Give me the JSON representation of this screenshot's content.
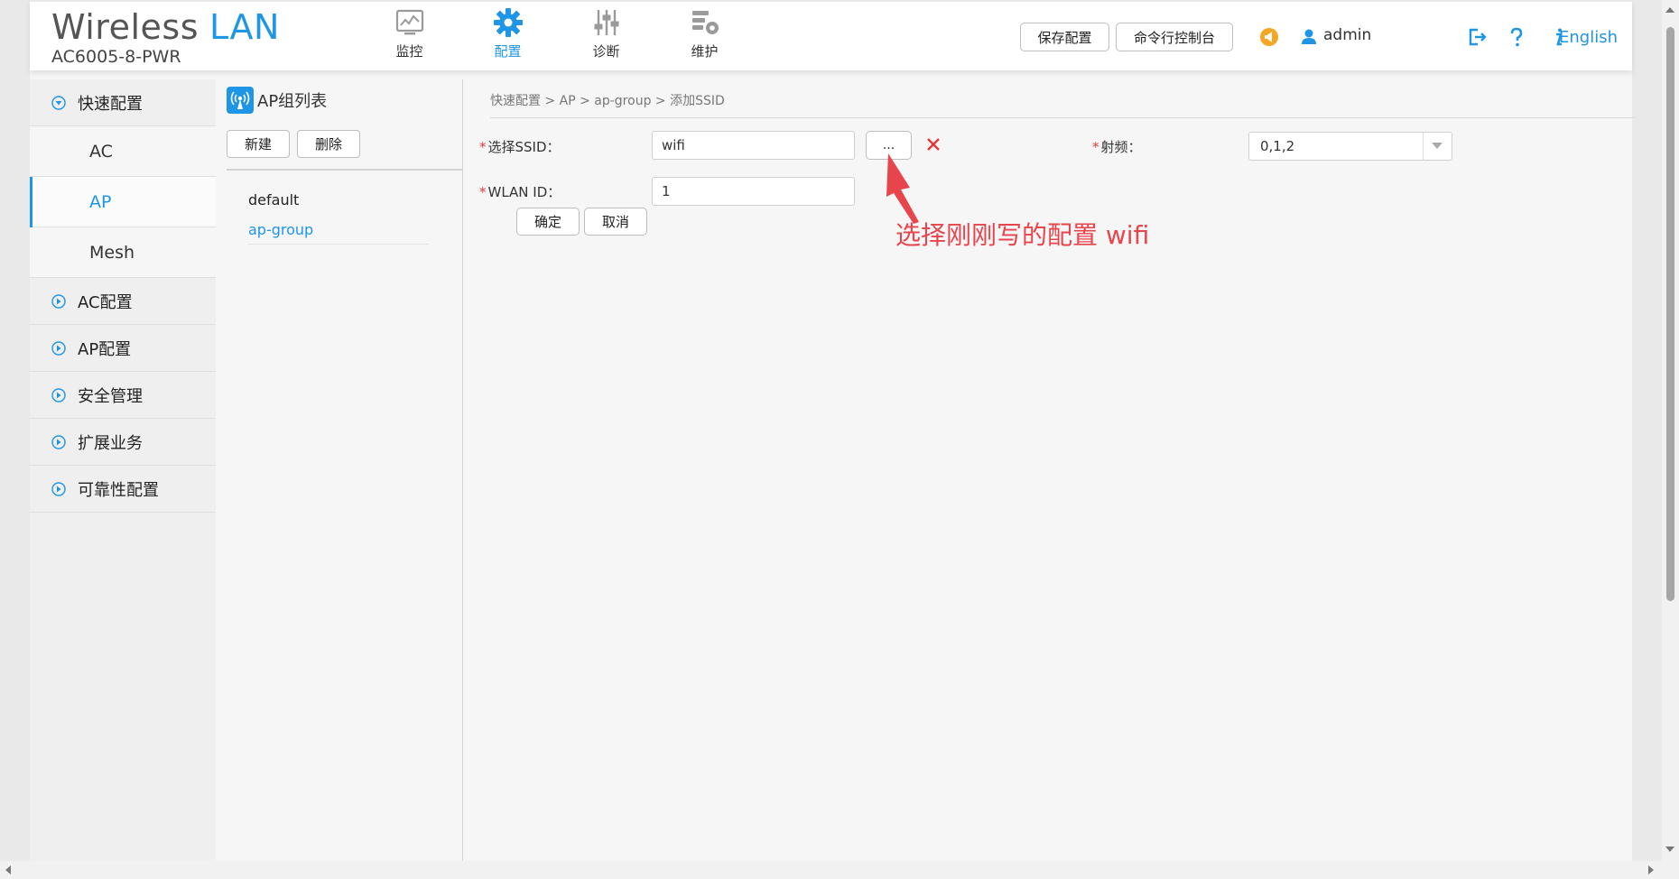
{
  "header": {
    "logo_word1": "Wireless",
    "logo_word2": "LAN",
    "model": "AC6005-8-PWR",
    "nav": [
      {
        "label": "监控",
        "icon": "monitor-icon"
      },
      {
        "label": "配置",
        "icon": "gear-icon",
        "active": true
      },
      {
        "label": "诊断",
        "icon": "sliders-icon"
      },
      {
        "label": "维护",
        "icon": "maintenance-icon"
      }
    ],
    "save_config_label": "保存配置",
    "cli_console_label": "命令行控制台",
    "user": "admin",
    "language": "English",
    "icons": [
      "alarm-icon",
      "user-icon",
      "logout-icon",
      "help-icon",
      "info-icon"
    ]
  },
  "sidebar": {
    "quick_config": "快速配置",
    "sub_items": [
      "AC",
      "AP",
      "Mesh"
    ],
    "active_sub": "AP",
    "sections": [
      "AC配置",
      "AP配置",
      "安全管理",
      "扩展业务",
      "可靠性配置"
    ]
  },
  "group_panel": {
    "title": "AP组列表",
    "new_label": "新建",
    "delete_label": "删除",
    "items": [
      "default",
      "ap-group"
    ],
    "selected": "ap-group"
  },
  "main": {
    "breadcrumb": "快速配置 > AP > ap-group > 添加SSID",
    "ssid_label": "选择SSID：",
    "ssid_value": "wifi",
    "browse_label": "...",
    "wlan_id_label": "WLAN ID：",
    "wlan_id_value": "1",
    "radio_label": "射频：",
    "radio_value": "0,1,2",
    "ok_label": "确定",
    "cancel_label": "取消",
    "annotation": "选择刚刚写的配置 wifi"
  },
  "colors": {
    "accent": "#1f95e6",
    "required": "#e53935",
    "annotation": "#e8444b",
    "alarm": "#f5a623"
  }
}
